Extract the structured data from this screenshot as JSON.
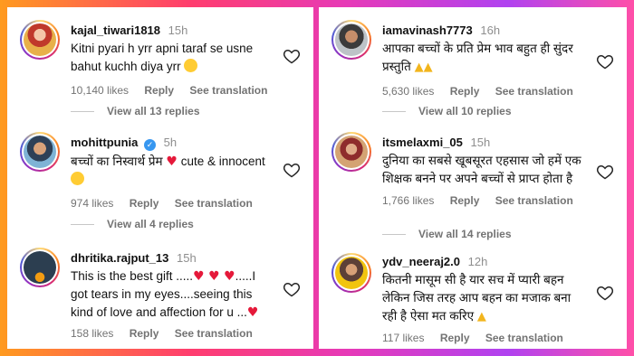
{
  "left": {
    "comments": [
      {
        "username": "kajal_tiwari1818",
        "time": "15h",
        "text": "Kitni pyari h yrr apni taraf se usne bahut kuchh diya yrr",
        "likes": "10,140 likes",
        "reply": "Reply",
        "see_translation": "See translation",
        "view_replies": "View all 13 replies"
      },
      {
        "username": "mohittpunia",
        "time": "5h",
        "text_a": "बच्चों का निस्वार्थ प्रेम",
        "text_b": "cute & innocent",
        "likes": "974 likes",
        "reply": "Reply",
        "see_translation": "See translation",
        "view_replies": "View all 4 replies"
      },
      {
        "username": "dhritika.rajput_13",
        "time": "15h",
        "text_a": "This is the best gift .....",
        "text_b": ".....I got tears in my eyes....seeing this kind of love and affection for u ...",
        "likes": "158 likes",
        "reply": "Reply",
        "see_translation": "See translation"
      }
    ]
  },
  "right": {
    "comments": [
      {
        "username": "iamavinash7773",
        "time": "16h",
        "text": "आपका बच्चों के प्रति प्रेम भाव बहुत ही सुंदर प्रस्तुति",
        "likes": "5,630 likes",
        "reply": "Reply",
        "see_translation": "See translation",
        "view_replies": "View all 10 replies"
      },
      {
        "username": "itsmelaxmi_05",
        "time": "15h",
        "text": "दुनिया का सबसे खूबसूरत एहसास जो हमें एक शिक्षक बनने पर अपने बच्चों से प्राप्त होता है",
        "likes": "1,766 likes",
        "reply": "Reply",
        "see_translation": "See translation",
        "view_replies": "View all 14 replies"
      },
      {
        "username": "ydv_neeraj2.0",
        "time": "12h",
        "text": "कितनी मासूम सी है यार सच में प्यारी बहन लेकिन जिस तरह आप बहन का मजाक बना रही है ऐसा मत करिए",
        "likes": "117 likes",
        "reply": "Reply",
        "see_translation": "See translation"
      }
    ]
  },
  "colors": {
    "verified": "#3797f0",
    "heart": "#e5193a",
    "muted": "#737373"
  }
}
